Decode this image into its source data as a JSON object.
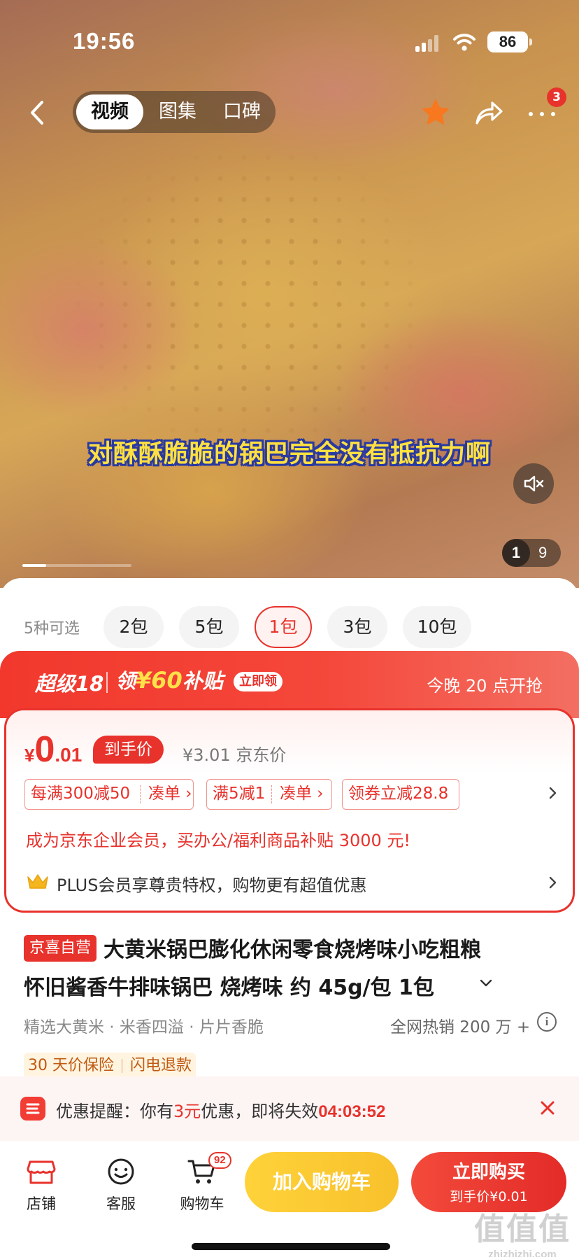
{
  "status_bar": {
    "time": "19:56",
    "battery": "86"
  },
  "nav": {
    "tabs": [
      {
        "label": "视频",
        "active": true
      },
      {
        "label": "图集",
        "active": false
      },
      {
        "label": "口碑",
        "active": false
      }
    ],
    "more_badge": "3",
    "icons": [
      "back-icon",
      "star-icon",
      "share-icon",
      "more-icon"
    ]
  },
  "media": {
    "subtitle": "对酥酥脆脆的锅巴完全没有抵抗力啊",
    "current_page": "1",
    "total_pages": "9",
    "progress": 0.22
  },
  "variants": {
    "count_label": "5种可选",
    "options": [
      {
        "label": "2包",
        "selected": false
      },
      {
        "label": "5包",
        "selected": false
      },
      {
        "label": "1包",
        "selected": true
      },
      {
        "label": "3包",
        "selected": false
      },
      {
        "label": "10包",
        "selected": false
      }
    ]
  },
  "promo": {
    "title": "超级18",
    "subsidy_prefix": "领",
    "subsidy_amount": "¥60",
    "subsidy_suffix": "补贴",
    "tag": "立即领",
    "time": "今晚 20 点开抢"
  },
  "price": {
    "currency": "¥",
    "integer": "0",
    "decimal": ".01",
    "final_tag": "到手价",
    "jd_price": "¥3.01 京东价",
    "coupons": [
      {
        "parts": [
          "每满300减50",
          "凑单 ›"
        ]
      },
      {
        "parts": [
          "满5减1",
          "凑单 ›"
        ]
      },
      {
        "parts": [
          "领券立减28.8"
        ]
      }
    ],
    "enterprise": "成为京东企业会员，买办公/福利商品补贴 3000 元!",
    "plus": "PLUS会员享尊贵特权，购物更有超值优惠"
  },
  "product": {
    "badge": "京喜自营",
    "title_line1": "大黄米锅巴膨化休闲零食烧烤味小吃粗粮",
    "title_line2": "怀旧酱香牛排味锅巴 烧烤味 约 45g/包 1包",
    "features": "精选大黄米 · 米香四溢 · 片片香脆",
    "sales": "全网热销 200 万 +",
    "services": [
      "30 天价保险",
      "闪电退款"
    ]
  },
  "reminder": {
    "prefix": "优惠提醒：你有",
    "amount": "3元",
    "middle": "优惠，即将失效",
    "countdown": "04:03:52"
  },
  "bottom": {
    "store": "店铺",
    "service": "客服",
    "cart": "购物车",
    "cart_count": "92",
    "add_to_cart": "加入购物车",
    "buy_now": "立即购买",
    "buy_now_price": "到手价¥0.01"
  },
  "watermark": {
    "big": "值值值",
    "small": "zhizhizhi.com"
  },
  "colors": {
    "accent": "#e8322c",
    "cart_button": "#f8c12c",
    "promo_price": "#ffe14a"
  }
}
